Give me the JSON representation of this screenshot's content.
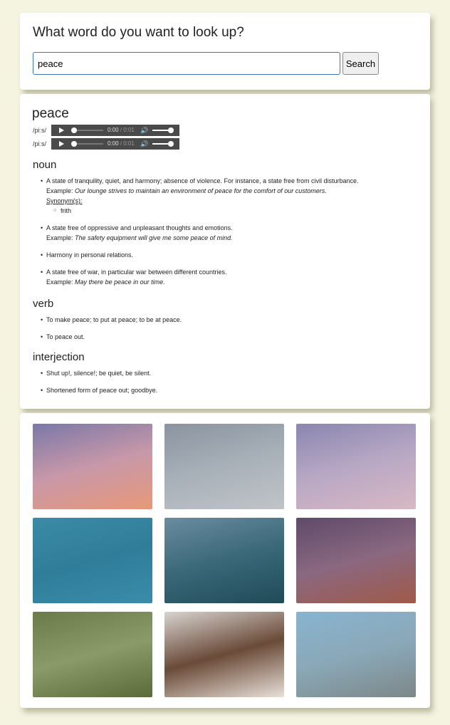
{
  "search": {
    "heading": "What word do you want to look up?",
    "query": "peace",
    "button_label": "Search"
  },
  "entry": {
    "word": "peace",
    "phonetics": [
      {
        "text": "/piːs/",
        "current_time": "0:00",
        "duration": "/ 0:01"
      },
      {
        "text": "/piːs/",
        "current_time": "0:00",
        "duration": "/ 0:01"
      }
    ],
    "noun": {
      "label": "noun",
      "definitions": [
        {
          "text": "A state of tranquility, quiet, and harmony; absence of violence. For instance, a state free from civil disturbance.",
          "example_label": "Example:",
          "example": "Our lounge strives to maintain an environment of peace for the comfort of our customers.",
          "synonyms_label": "Synonym(s):",
          "synonyms": [
            "frith"
          ]
        },
        {
          "text": "A state free of oppressive and unpleasant thoughts and emotions.",
          "example_label": "Example:",
          "example": "The safety equipment will give me some peace of mind."
        },
        {
          "text": "Harmony in personal relations."
        },
        {
          "text": "A state free of war, in particular war between different countries.",
          "example_label": "Example:",
          "example": "May there be peace in our time."
        }
      ]
    },
    "verb": {
      "label": "verb",
      "definitions": [
        {
          "text": "To make peace; to put at peace; to be at peace."
        },
        {
          "text": "To peace out."
        }
      ]
    },
    "interjection": {
      "label": "interjection",
      "definitions": [
        {
          "text": "Shut up!, silence!; be quiet, be silent."
        },
        {
          "text": "Shortened form of peace out; goodbye."
        }
      ]
    }
  },
  "images": [
    {
      "name": "photo-hands-reaching-sunset-sky",
      "colors": [
        "#7a78a8",
        "#c898a8",
        "#e89878"
      ]
    },
    {
      "name": "photo-woman-on-swing-grey-sky",
      "colors": [
        "#8a94a0",
        "#a8b0b8",
        "#c0c4c8"
      ]
    },
    {
      "name": "photo-purple-clouds-sky",
      "colors": [
        "#8a86b0",
        "#b8a8c4",
        "#d8b8c4"
      ]
    },
    {
      "name": "photo-white-dove-on-hand-blue",
      "colors": [
        "#3b8aa6",
        "#2f7d99",
        "#3a8cab"
      ]
    },
    {
      "name": "photo-swing-over-water-dusk",
      "colors": [
        "#6a8ca0",
        "#3a6878",
        "#1f4a58"
      ]
    },
    {
      "name": "photo-purple-sunset-sea-shore",
      "colors": [
        "#5e4a6a",
        "#8a6880",
        "#a05a48"
      ]
    },
    {
      "name": "photo-person-lying-on-grass-palms",
      "colors": [
        "#6a7a48",
        "#8a9a68",
        "#5a6a38"
      ]
    },
    {
      "name": "photo-woman-meditating-praying-hands",
      "colors": [
        "#d8d4d0",
        "#6a4a38",
        "#e8e0d8"
      ]
    },
    {
      "name": "photo-woman-meditating-on-rock-sea",
      "colors": [
        "#88b4d0",
        "#8aa8b8",
        "#7c8888"
      ]
    }
  ],
  "colors": {
    "page_background": "#f5f4e0",
    "card_background": "#ffffff",
    "input_border": "#3a76b4",
    "audio_player": "#4a4a4a"
  }
}
